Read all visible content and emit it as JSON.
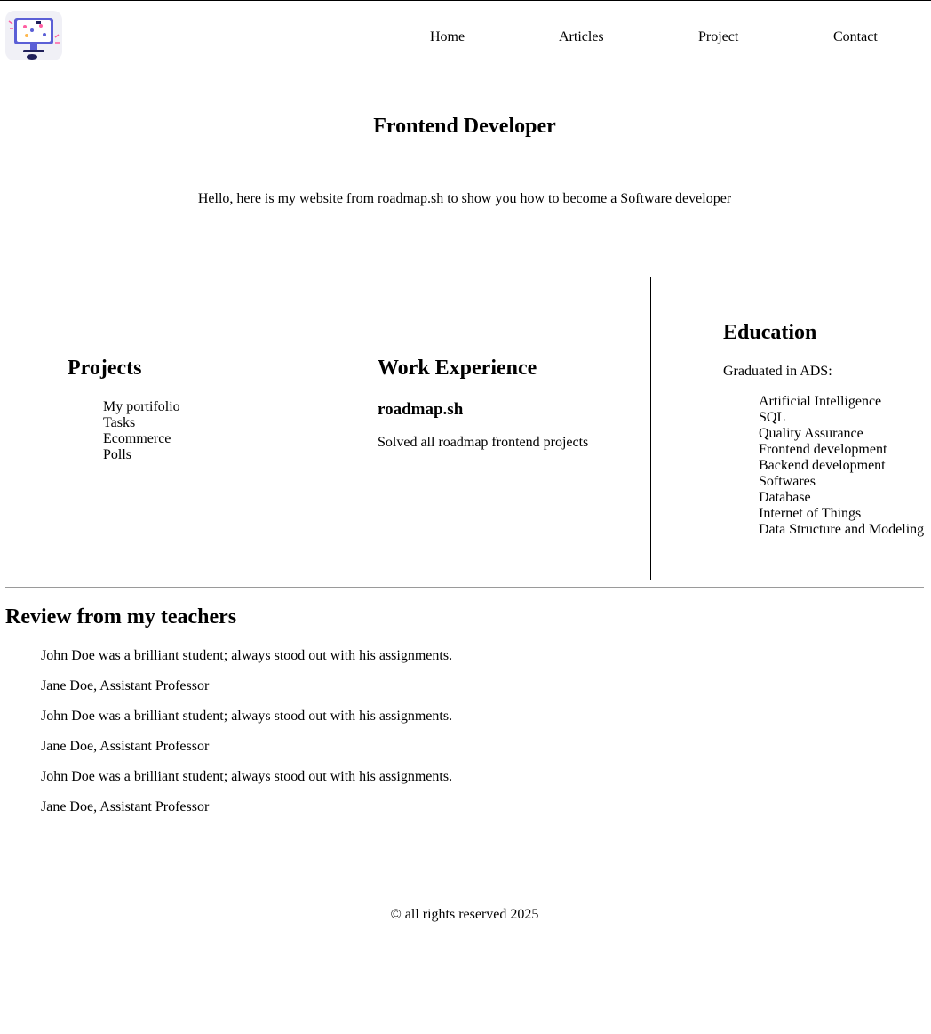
{
  "nav": {
    "logo_alt": "developer illustration",
    "links": [
      "Home",
      "Articles",
      "Project",
      "Contact"
    ]
  },
  "hero": {
    "title": "Frontend Developer",
    "text": "Hello, here is my website from roadmap.sh to show you how to become a Software developer"
  },
  "projects": {
    "heading": "Projects",
    "items": [
      "My portifolio",
      "Tasks",
      "Ecommerce",
      "Polls"
    ]
  },
  "work": {
    "heading": "Work Experience",
    "company": "roadmap.sh",
    "description": "Solved all roadmap frontend projects"
  },
  "education": {
    "heading": "Education",
    "intro": "Graduated in ADS:",
    "items": [
      "Artificial Intelligence",
      "SQL",
      "Quality Assurance",
      "Frontend development",
      "Backend development",
      "Softwares",
      "Database",
      "Internet of Things",
      "Data Structure and Modeling"
    ]
  },
  "reviews": {
    "heading": "Review from my teachers",
    "entries": [
      {
        "quote": "John Doe was a brilliant student; always stood out with his assignments.",
        "author": "Jane Doe, Assistant Professor"
      },
      {
        "quote": "John Doe was a brilliant student; always stood out with his assignments.",
        "author": "Jane Doe, Assistant Professor"
      },
      {
        "quote": "John Doe was a brilliant student; always stood out with his assignments.",
        "author": "Jane Doe, Assistant Professor"
      }
    ]
  },
  "footer": {
    "text": "© all rights reserved 2025"
  },
  "colors": {
    "text": "#000000",
    "background": "#ffffff",
    "divider": "#9a9a9a"
  }
}
